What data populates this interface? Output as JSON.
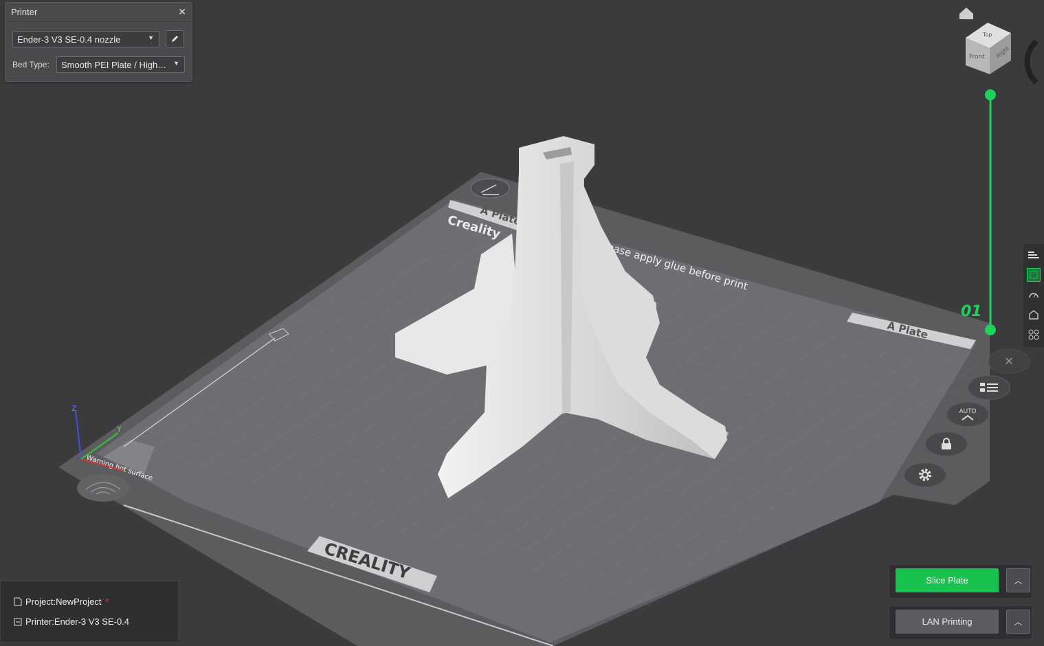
{
  "printer_panel": {
    "title": "Printer",
    "printer_preset": "Ender-3 V3 SE-0.4 nozzle",
    "bed_type_label": "Bed Type:",
    "bed_type_value": "Smooth PEI Plate / High…"
  },
  "viewport": {
    "plate_labels": [
      "A Plate",
      "A Plate"
    ],
    "plate_texts": [
      "Creality",
      "Please apply glue before print",
      "Warning hot surface",
      "CREALITY"
    ],
    "layer_slider_value": "01",
    "view_cube": {
      "top": "Top",
      "front": "Front",
      "right": "Right"
    }
  },
  "toolbar": {
    "auto_label": "AUTO"
  },
  "actions": {
    "slice_label": "Slice Plate",
    "lan_label": "LAN Printing",
    "accent": "#17c34e"
  },
  "info": {
    "project_label": "Project:NewProject",
    "project_modified_marker": "*",
    "printer_label": "Printer:Ender-3 V3 SE-0.4"
  }
}
